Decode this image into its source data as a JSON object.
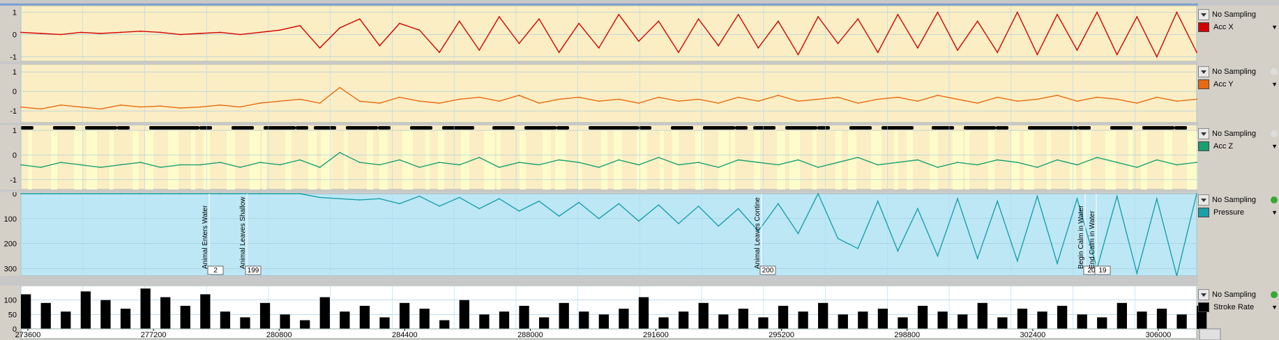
{
  "chart_data": [
    {
      "type": "line",
      "series": [
        {
          "name": "Acc X",
          "values": [
            0.1,
            0.05,
            0.0,
            0.1,
            0.05,
            0.1,
            0.15,
            0.1,
            0.0,
            0.05,
            0.1,
            0.0,
            0.1,
            0.2,
            0.4,
            -0.6,
            0.3,
            0.7,
            -0.5,
            0.5,
            0.2,
            -0.8,
            0.6,
            -0.7,
            0.8,
            -0.4,
            0.7,
            -0.8,
            0.5,
            -0.6,
            0.9,
            -0.3,
            0.6,
            -0.8,
            0.7,
            -0.5,
            0.9,
            -0.6,
            0.6,
            -0.9,
            0.8,
            -0.4,
            0.7,
            -0.8,
            0.9,
            -0.6,
            1.0,
            -0.7,
            0.6,
            -0.8,
            1.0,
            -0.9,
            0.9,
            -0.7,
            1.0,
            -0.9,
            0.8,
            -1.0,
            1.0,
            -0.8
          ]
        }
      ],
      "color": "#d40000",
      "ylim": [
        -1.2,
        1.3
      ],
      "ytick_labels": [
        "1",
        "0",
        "-1"
      ],
      "ytick_values": [
        1,
        0,
        -1
      ]
    },
    {
      "type": "line",
      "series": [
        {
          "name": "Acc Y",
          "values": [
            -0.8,
            -0.9,
            -0.7,
            -0.8,
            -0.9,
            -0.7,
            -0.8,
            -0.75,
            -0.85,
            -0.8,
            -0.7,
            -0.8,
            -0.6,
            -0.5,
            -0.4,
            -0.6,
            0.2,
            -0.5,
            -0.6,
            -0.3,
            -0.5,
            -0.6,
            -0.4,
            -0.3,
            -0.5,
            -0.2,
            -0.6,
            -0.4,
            -0.3,
            -0.5,
            -0.4,
            -0.6,
            -0.3,
            -0.5,
            -0.4,
            -0.6,
            -0.3,
            -0.5,
            -0.2,
            -0.5,
            -0.4,
            -0.3,
            -0.6,
            -0.4,
            -0.3,
            -0.5,
            -0.2,
            -0.4,
            -0.6,
            -0.3,
            -0.5,
            -0.4,
            -0.2,
            -0.5,
            -0.3,
            -0.4,
            -0.6,
            -0.3,
            -0.5,
            -0.4
          ]
        }
      ],
      "color": "#e86a10",
      "ylim": [
        -1.6,
        1.4
      ],
      "ytick_labels": [
        "1",
        "0",
        "-1"
      ],
      "ytick_values": [
        1,
        0,
        -1
      ]
    },
    {
      "type": "line",
      "series": [
        {
          "name": "Acc Z",
          "values": [
            -0.4,
            -0.5,
            -0.3,
            -0.4,
            -0.5,
            -0.4,
            -0.3,
            -0.5,
            -0.4,
            -0.4,
            -0.3,
            -0.5,
            -0.3,
            -0.4,
            -0.2,
            -0.5,
            0.1,
            -0.3,
            -0.4,
            -0.2,
            -0.5,
            -0.3,
            -0.4,
            -0.1,
            -0.5,
            -0.3,
            -0.4,
            -0.2,
            -0.3,
            -0.5,
            -0.2,
            -0.4,
            -0.1,
            -0.4,
            -0.3,
            -0.5,
            -0.2,
            -0.3,
            -0.4,
            -0.2,
            -0.5,
            -0.3,
            -0.1,
            -0.4,
            -0.3,
            -0.2,
            -0.5,
            -0.3,
            -0.4,
            -0.2,
            -0.3,
            -0.5,
            -0.2,
            -0.4,
            -0.1,
            -0.3,
            -0.5,
            -0.2,
            -0.4,
            -0.3
          ]
        }
      ],
      "color": "#18a070",
      "ylim": [
        -1.4,
        1.2
      ],
      "ytick_labels": [
        "1",
        "0",
        "-1"
      ],
      "ytick_values": [
        1,
        0,
        -1
      ]
    },
    {
      "type": "line",
      "series": [
        {
          "name": "Pressure",
          "values": [
            0,
            0,
            0,
            0,
            0,
            0,
            0,
            0,
            0,
            0,
            0,
            0,
            0,
            0,
            0,
            15,
            20,
            25,
            20,
            40,
            10,
            50,
            15,
            60,
            20,
            70,
            30,
            90,
            35,
            100,
            40,
            110,
            45,
            120,
            50,
            130,
            60,
            150,
            40,
            160,
            0,
            180,
            220,
            30,
            230,
            60,
            250,
            20,
            260,
            30,
            270,
            10,
            280,
            20,
            300,
            10,
            320,
            20,
            330,
            0
          ]
        }
      ],
      "color": "#1aa0a8",
      "ylim": [
        330,
        0
      ],
      "ytick_labels": [
        "0",
        "100",
        "200",
        "300"
      ],
      "ytick_values": [
        0,
        100,
        200,
        300
      ],
      "annotations": [
        {
          "label": "Animal Enters Water",
          "box": "2"
        },
        {
          "label": "Animal Leaves Shallow",
          "box": "199"
        },
        {
          "label": "Animal Leaves Contine",
          "box": "200"
        },
        {
          "label": "Begin Calm in Water",
          "box": "20"
        },
        {
          "label": "End Calm in Water",
          "box": "19"
        }
      ]
    },
    {
      "type": "bar",
      "series": [
        {
          "name": "Stroke Rate",
          "values": [
            120,
            90,
            60,
            130,
            100,
            70,
            140,
            110,
            80,
            120,
            60,
            40,
            90,
            50,
            30,
            110,
            60,
            80,
            40,
            90,
            70,
            30,
            100,
            50,
            60,
            80,
            40,
            90,
            60,
            50,
            70,
            110,
            40,
            60,
            90,
            50,
            70,
            40,
            80,
            60,
            90,
            50,
            60,
            70,
            40,
            80,
            60,
            50,
            90,
            40,
            70,
            60,
            80,
            50,
            40,
            90,
            60,
            70,
            50,
            80
          ]
        }
      ],
      "color": "#000000",
      "ylim": [
        0,
        150
      ],
      "ytick_labels": [
        "100",
        "50",
        "0"
      ],
      "ytick_values": [
        100,
        50,
        0
      ],
      "x_tick_labels": [
        "273600",
        "277200",
        "280800",
        "284400",
        "288000",
        "291600",
        "295200",
        "298800",
        "302400",
        "306000"
      ],
      "x_tick_values": [
        273600,
        277200,
        280800,
        284400,
        288000,
        291600,
        295200,
        298800,
        302400,
        306000
      ],
      "xlim": [
        273400,
        307100
      ]
    }
  ],
  "side_panels": [
    {
      "sampling": "No Sampling",
      "channel": "Acc X",
      "color": "#d40000"
    },
    {
      "sampling": "No Sampling",
      "channel": "Acc Y",
      "color": "#e86a10"
    },
    {
      "sampling": "No Sampling",
      "channel": "Acc Z",
      "color": "#18a070"
    },
    {
      "sampling": "No Sampling",
      "channel": "Pressure",
      "color": "#1aa0a8"
    },
    {
      "sampling": "No Sampling",
      "channel": "Stroke Rate",
      "color": "#000000"
    }
  ]
}
